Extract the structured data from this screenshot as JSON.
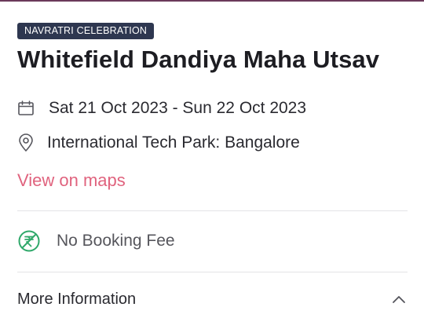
{
  "event": {
    "category_badge": "NAVRATRI CELEBRATION",
    "title": "Whitefield Dandiya Maha Utsav",
    "date_range": "Sat 21 Oct 2023 - Sun 22 Oct 2023",
    "venue": "International Tech Park: Bangalore",
    "maps_link_label": "View on maps",
    "booking_fee_label": "No Booking Fee",
    "more_info_label": "More Information"
  },
  "icons": {
    "date": "calendar-icon",
    "venue": "location-pin-icon",
    "fee": "no-fee-rupee-icon",
    "expand": "chevron-up-icon"
  },
  "colors": {
    "badge_bg": "#2e3750",
    "link": "#e0637e",
    "fee_icon": "#2fa86a",
    "top_accent": "#6b3a5a"
  }
}
